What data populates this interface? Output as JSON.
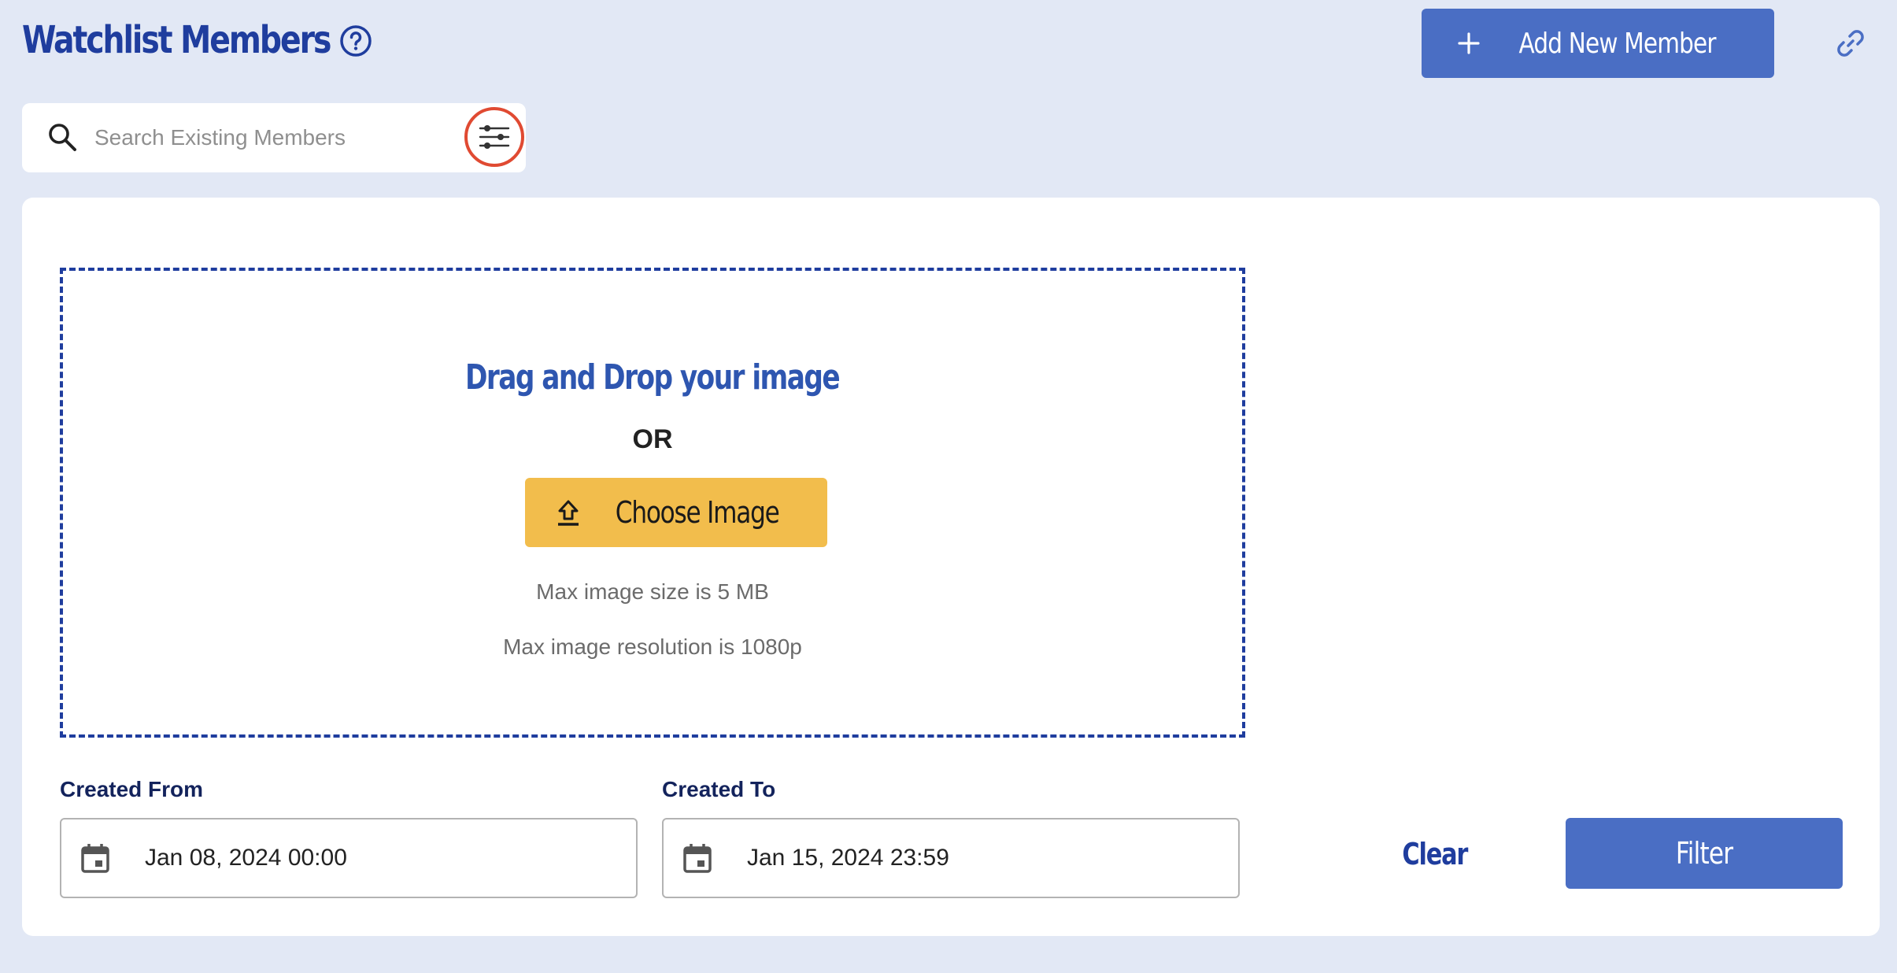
{
  "header": {
    "title": "Watchlist Members",
    "add_member_label": "Add New Member"
  },
  "search": {
    "placeholder": "Search Existing Members",
    "value": ""
  },
  "upload": {
    "title": "Drag and Drop your image",
    "or_label": "OR",
    "choose_label": "Choose Image",
    "max_size_hint": "Max image size is 5 MB",
    "max_resolution_hint": "Max image resolution is 1080p"
  },
  "filters": {
    "created_from_label": "Created From",
    "created_from_value": "Jan 08, 2024 00:00",
    "created_to_label": "Created To",
    "created_to_value": "Jan 15, 2024 23:59",
    "clear_label": "Clear",
    "filter_label": "Filter"
  },
  "icons": {
    "help": "help-icon",
    "add": "plus-icon",
    "link": "link-icon",
    "search": "search-icon",
    "filter_toggle": "sliders-icon",
    "upload": "upload-icon",
    "calendar": "calendar-icon"
  },
  "colors": {
    "page_background": "#e2e8f5",
    "primary": "#4a6ec4",
    "title": "#1f3d9e",
    "accent_button": "#f2bd4c",
    "highlight_ring": "#e04a32"
  }
}
